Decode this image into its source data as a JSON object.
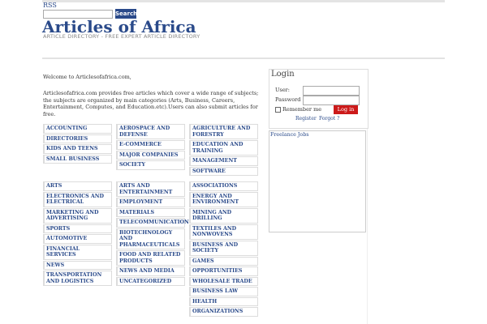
{
  "header": {
    "rss_label": "RSS",
    "search_placeholder": "",
    "search_button": "Search",
    "site_title": "Articles of Africa",
    "tagline": "ARTICLE DIRECTORY - FREE EXPERT ARTICLE DIRECTORY"
  },
  "content": {
    "welcome": "Welcome to Articlesofafrica.com,",
    "intro": "Articlesofafrica.com provides free articles which cover a wide range of subjects; the subjects are organized by main categories (Arts, Business, Careers, Entertainment, Computes, and Education.etc).Users can also submit articles for free."
  },
  "categories": {
    "col1_top": [
      "ACCOUNTING",
      "DIRECTORIES",
      "KIDS AND TEENS",
      "SMALL BUSINESS"
    ],
    "col2_top": [
      "AEROSPACE AND DEFENSE",
      "E-COMMERCE",
      "MAJOR COMPANIES",
      "SOCIETY"
    ],
    "col3_top": [
      "AGRICULTURE AND FORESTRY",
      "EDUCATION AND TRAINING",
      "MANAGEMENT",
      "SOFTWARE"
    ],
    "col1_bottom": [
      "ARTS",
      "ELECTRONICS AND ELECTRICAL",
      "MARKETING AND ADVERTISING",
      "SPORTS",
      "AUTOMOTIVE",
      "FINANCIAL SERVICES",
      "NEWS",
      "TRANSPORTATION AND LOGISTICS"
    ],
    "col2_bottom": [
      "ARTS AND ENTERTAINMENT",
      "EMPLOYMENT",
      "MATERIALS",
      "TELECOMMUNICATIONS",
      "BIOTECHNOLOGY AND PHARMACEUTICALS",
      "FOOD AND RELATED PRODUCTS",
      "NEWS AND MEDIA",
      "UNCATEGORIZED"
    ],
    "col3_bottom": [
      "ASSOCIATIONS",
      "ENERGY AND ENVIRONMENT",
      "MINING AND DRILLING",
      "TEXTILES AND NONWOVENS",
      "BUSINESS AND SOCIETY",
      "GAMES",
      "OPPORTUNITIES",
      "WHOLESALE TRADE",
      "BUSINESS LAW",
      "HEALTH",
      "ORGANIZATIONS"
    ]
  },
  "login": {
    "title": "Login",
    "user_label": "User:",
    "password_label": "Password",
    "remember_label": "Remember me",
    "login_button": "Log in",
    "register_link": "Register",
    "forgot_link": "Forgot ?"
  },
  "sidebar": {
    "freelance_link": "Freelance Jobs"
  },
  "colors": {
    "brand_blue": "#2a4a8a",
    "login_red": "#cc1a1a"
  }
}
